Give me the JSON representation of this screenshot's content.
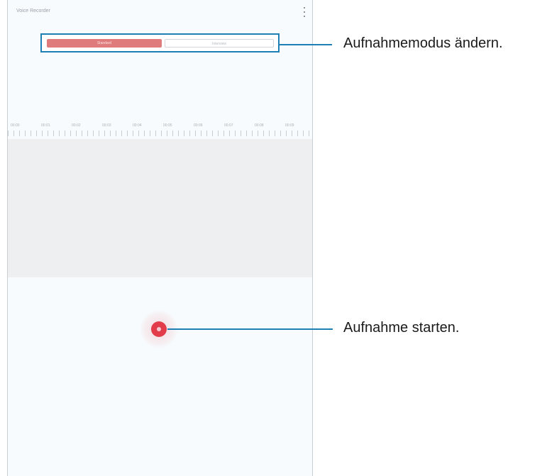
{
  "app": {
    "title": "Voice Recorder"
  },
  "mode_tabs": [
    {
      "label": "Standard",
      "selected": true
    },
    {
      "label": "Interview",
      "selected": false
    }
  ],
  "timeline": {
    "tick_labels": [
      "00:00",
      "00:01",
      "00:02",
      "00:03",
      "00:04",
      "00:05",
      "00:06",
      "00:07",
      "00:08",
      "00:09"
    ]
  },
  "callouts": {
    "mode": "Aufnahmemodus ändern.",
    "record": "Aufnahme starten."
  },
  "colors": {
    "accent": "#1e7fb5",
    "record": "#e23b4a",
    "active_tab": "#e07b7b"
  },
  "icons": {
    "menu": "more-vertical-icon",
    "record": "record-icon"
  }
}
